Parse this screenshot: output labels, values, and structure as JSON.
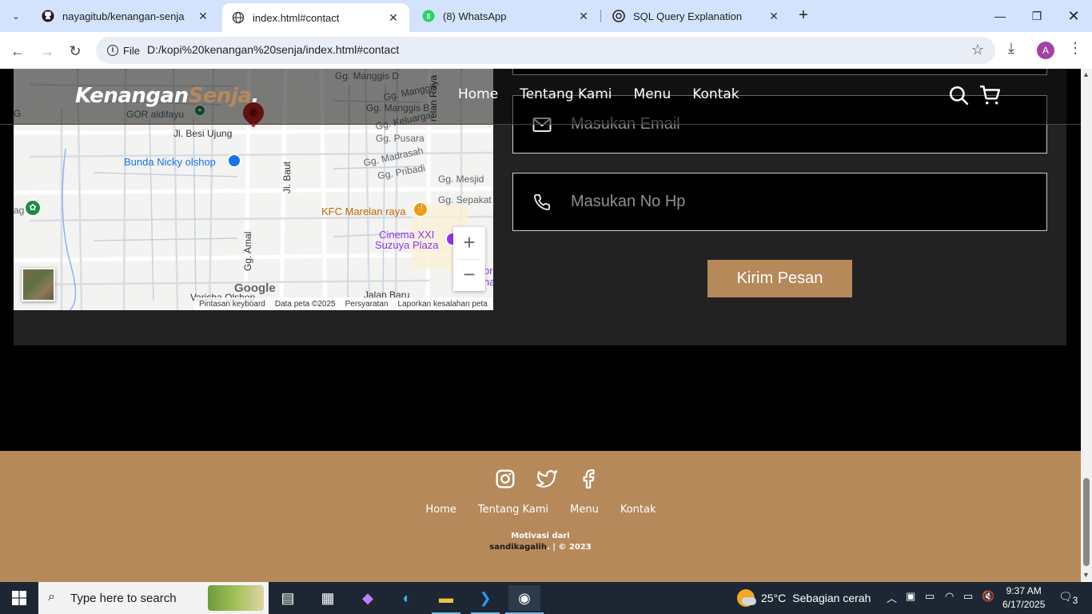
{
  "browser": {
    "tabs": [
      {
        "title": "nayagitub/kenangan-senja",
        "icon": "github-icon",
        "active": false
      },
      {
        "title": "index.html#contact",
        "icon": "globe-icon",
        "active": true
      },
      {
        "title": "(8) WhatsApp",
        "icon": "whatsapp-icon",
        "active": false
      },
      {
        "title": "SQL Query Explanation",
        "icon": "openai-icon",
        "active": false
      }
    ],
    "address": {
      "chip": "File",
      "url": "D:/kopi%20kenangan%20senja/index.html#contact"
    },
    "profile_initial": "A"
  },
  "site": {
    "logo_main": "Kenangan",
    "logo_accent": "Senja",
    "logo_dot": ".",
    "nav": {
      "home": "Home",
      "about": "Tentang Kami",
      "menu": "Menu",
      "contact": "Kontak"
    },
    "colors": {
      "accent": "#b6895b",
      "panel": "#222222"
    }
  },
  "map": {
    "labels": {
      "gor": "GOR aldifayu",
      "besi_ujung": "Jl. Besi Ujung",
      "bunda_nicky": "Bunda Nicky olshop",
      "baut": "Jl. Baut",
      "amal": "Gg. Amal",
      "kfc": "KFC Marelan raya",
      "cinema": "Cinema XXI",
      "suzuya": "Suzuya Plaza",
      "pusara": "Gg. Pusara",
      "madrasah": "Gg. Madrasah",
      "pribadi": "Gg. Pribadi",
      "mesjid": "Gg. Mesjid",
      "sepakat": "Gg. Sepakat",
      "manggis_d": "Gg. Manggis D",
      "manggis": "Gg. Manggis",
      "manggis_b": "Gg. Manggis B",
      "keluarga": "Gg. Keluarga",
      "marelan_raya": "relan Raya",
      "varisha": "Varisha Olshop",
      "baru": "Jalan Baru",
      "edge_g": "G",
      "edge_ag": "ag",
      "edge_ora": "ora",
      "edge_nar": "nar"
    },
    "google": "Google",
    "attribution": {
      "keyboard": "Pintasan keyboard",
      "data": "Data peta ©2025",
      "terms": "Persyaratan",
      "report": "Laporkan kesalahan peta"
    },
    "zoom_in": "+",
    "zoom_out": "−"
  },
  "form": {
    "email_placeholder": "Masukan Email",
    "phone_placeholder": "Masukan No Hp",
    "submit_label": "Kirim Pesan"
  },
  "footer": {
    "socials": [
      "instagram-icon",
      "twitter-icon",
      "facebook-icon"
    ],
    "links": {
      "home": "Home",
      "about": "Tentang Kami",
      "menu": "Menu",
      "contact": "Kontak"
    },
    "credit_line1": "Motivasi dari",
    "credit_author": "sandikagalih",
    "credit_rest": ". | © 2023"
  },
  "taskbar": {
    "search_placeholder": "Type here to search",
    "weather": {
      "temp": "25°C",
      "desc": "Sebagian cerah",
      "badge": "1"
    },
    "time": "9:37 AM",
    "date": "6/17/2025",
    "notifications": "3"
  }
}
